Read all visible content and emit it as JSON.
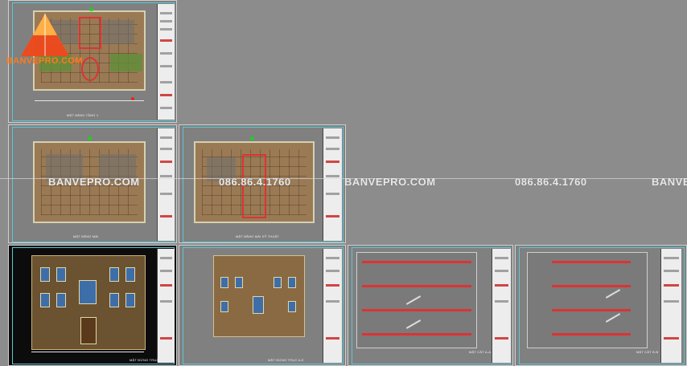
{
  "watermark": {
    "brand": "BANVEPRO.COM",
    "phone": "086.86.4.1760",
    "brand_cut": "BANVE"
  },
  "logo": {
    "text": "BANVEPRO.COM"
  },
  "colors": {
    "background": "#8c8c8c",
    "frame": "#59c7d6",
    "plan_fill": "#9a7a55",
    "accent_red": "#d33333",
    "green": "#5f8f38",
    "logo_orange": "#ff7a1a"
  },
  "sheets": [
    {
      "caption": "MẶT BẰNG TẦNG 1"
    },
    {
      "caption": "MẶT BẰNG MÁI"
    },
    {
      "caption": "MẶT BẰNG MÁI KỸ THUẬT"
    },
    {
      "caption": "MẶT ĐỨNG TRỤC 1-6"
    },
    {
      "caption": "MẶT ĐỨNG TRỤC A-E"
    },
    {
      "caption": "MẶT CẮT A-A"
    },
    {
      "caption": "MẶT CẮT B-B"
    }
  ]
}
